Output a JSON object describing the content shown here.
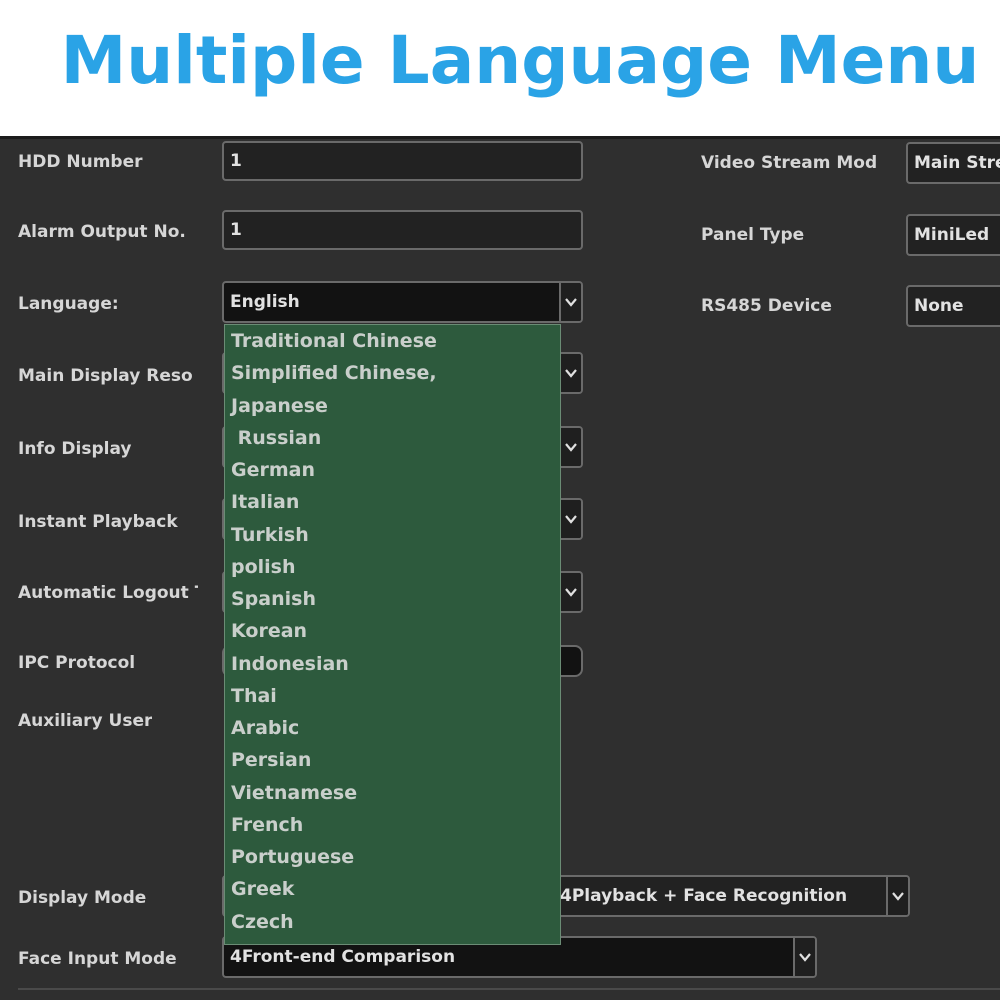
{
  "banner": {
    "title": "Multiple Language Menu"
  },
  "settings": {
    "hdd_number": {
      "label": "HDD Number",
      "value": "1"
    },
    "alarm_output": {
      "label": "Alarm Output No.",
      "value": "1"
    },
    "language": {
      "label": "Language:",
      "value": "English"
    },
    "main_display": {
      "label": "Main Display Reso"
    },
    "info_display": {
      "label": "Info Display"
    },
    "instant_playback": {
      "label": "Instant Playback"
    },
    "auto_logout": {
      "label": "Automatic Logout T"
    },
    "ipc_protocol": {
      "label": "IPC Protocol"
    },
    "auxiliary_user": {
      "label": "Auxiliary User"
    },
    "display_mode": {
      "label": "Display Mode",
      "value": "4Playback + Face Recognition"
    },
    "face_input_mode": {
      "label": "Face Input Mode",
      "value": "4Front-end Comparison"
    },
    "video_stream_mode": {
      "label": "Video Stream Mod",
      "value": "Main Stre"
    },
    "panel_type": {
      "label": "Panel Type",
      "value": "MiniLed"
    },
    "rs485_device": {
      "label": "RS485 Device",
      "value": "None"
    }
  },
  "language_options": [
    "Traditional Chinese",
    "Simplified Chinese,",
    "Japanese",
    " Russian",
    "German",
    "Italian",
    "Turkish",
    "polish",
    "Spanish",
    "Korean",
    "Indonesian",
    "Thai",
    "Arabic",
    "Persian",
    "Vietnamese",
    "French",
    "Portuguese",
    "Greek",
    "Czech"
  ],
  "icons": {
    "dropdown_arrow": "chevron-down-icon"
  },
  "colors": {
    "title": "#2aa3e6",
    "panel": "#2f2f2f",
    "dropdown_bg": "#2d5a3d",
    "text": "#d6d6d6"
  }
}
